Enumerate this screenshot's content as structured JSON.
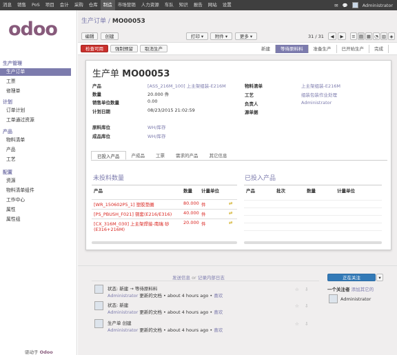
{
  "topbar": {
    "menus": [
      "消息",
      "销售",
      "PoS",
      "项目",
      "会计",
      "采购",
      "仓库",
      "制造",
      "市场营销",
      "人力资源",
      "车队",
      "知识",
      "报告",
      "网站",
      "设置"
    ],
    "active_index": 7,
    "user": "Administrator"
  },
  "sidebar": {
    "sections": [
      {
        "title": "生产管理",
        "items": [
          "生产订单",
          "工票",
          "修理单"
        ]
      },
      {
        "title": "计划",
        "items": [
          "订单计划",
          "工单通过资源"
        ]
      },
      {
        "title": "产品",
        "items": [
          "物料清单",
          "产品",
          "工艺"
        ]
      },
      {
        "title": "配置",
        "items": [
          "资源",
          "物料清单组件",
          "工作中心",
          "属性",
          "属性组"
        ]
      }
    ],
    "powered": "驱动于",
    "powered_brand": "Odoo"
  },
  "breadcrumb": {
    "parent": "生产订单",
    "sep": "/",
    "current": "MO00053"
  },
  "toolbar": {
    "edit": "编辑",
    "create": "创建",
    "print": "打印",
    "attachment": "附件",
    "more": "更多",
    "pager": "31 / 31"
  },
  "actions": {
    "check_availability": "检查可用",
    "force_reserve": "强制预留",
    "cancel": "取消生产"
  },
  "status": [
    "新建",
    "等待原料料",
    "准备生产",
    "已开始生产",
    "完成"
  ],
  "status_current": 1,
  "form": {
    "title_label": "生产单",
    "title_ref": "MO00053",
    "left": [
      {
        "label": "产品",
        "value": "[ASS_216M_100] 上主架组装-E216M",
        "link": true
      },
      {
        "label": "数量",
        "value": "20.000 件",
        "link": false
      },
      {
        "label": "销售单位数量",
        "value": "0.00",
        "link": false
      },
      {
        "label": "计划日期",
        "value": "08/23/2015 21:02:59",
        "link": false
      },
      {
        "label": "原料库位",
        "value": "WH/库存",
        "link": true
      },
      {
        "label": "成品库位",
        "value": "WH/库存",
        "link": true
      }
    ],
    "right": [
      {
        "label": "物料清单",
        "value": "上主架组装-E216M",
        "link": true
      },
      {
        "label": "工艺",
        "value": "组装包装作业处理",
        "link": true
      },
      {
        "label": "负责人",
        "value": "Administrator",
        "link": true
      },
      {
        "label": "源单据",
        "value": "",
        "link": false
      }
    ]
  },
  "tabs": [
    "已投入产品",
    "产成品",
    "工票",
    "需求的产品",
    "其它信息"
  ],
  "pending": {
    "title": "未投料数量",
    "headers": [
      "产品",
      "数量",
      "计量单位"
    ],
    "rows": [
      {
        "product": "[WR_150602P5_1] 塑胶垫圈",
        "qty": "80.000",
        "uom": "件"
      },
      {
        "product": "[PS_PBUSH_F021] 铜套(E216/E316)",
        "qty": "40.000",
        "uom": "件"
      },
      {
        "product": "[CX_316M_030] 上主架焊接-南瑞 砂(E316+216M)",
        "qty": "20.000",
        "uom": "件"
      }
    ]
  },
  "consumed": {
    "title": "已投入产品",
    "headers": [
      "产品",
      "批次",
      "数量",
      "计量单位"
    ]
  },
  "chatter": {
    "send": "发送信息",
    "or": "or",
    "log": "记录内部日志",
    "follow": "正在关注",
    "followers": "一个关注者",
    "add_others": "添加其它的",
    "follower_name": "Administrator",
    "messages": [
      {
        "line1": "状态: 新建 → 等待原料料",
        "author": "Administrator",
        "meta": "更新的文档 • about 4 hours ago •",
        "like": "喜欢"
      },
      {
        "line1": "状态: 新建",
        "author": "Administrator",
        "meta": "更新的文档 • about 4 hours ago •",
        "like": "喜欢"
      },
      {
        "line1": "生产单 创建",
        "author": "Administrator",
        "meta": "更新的文档 • about 4 hours ago •",
        "like": "喜欢"
      }
    ]
  }
}
